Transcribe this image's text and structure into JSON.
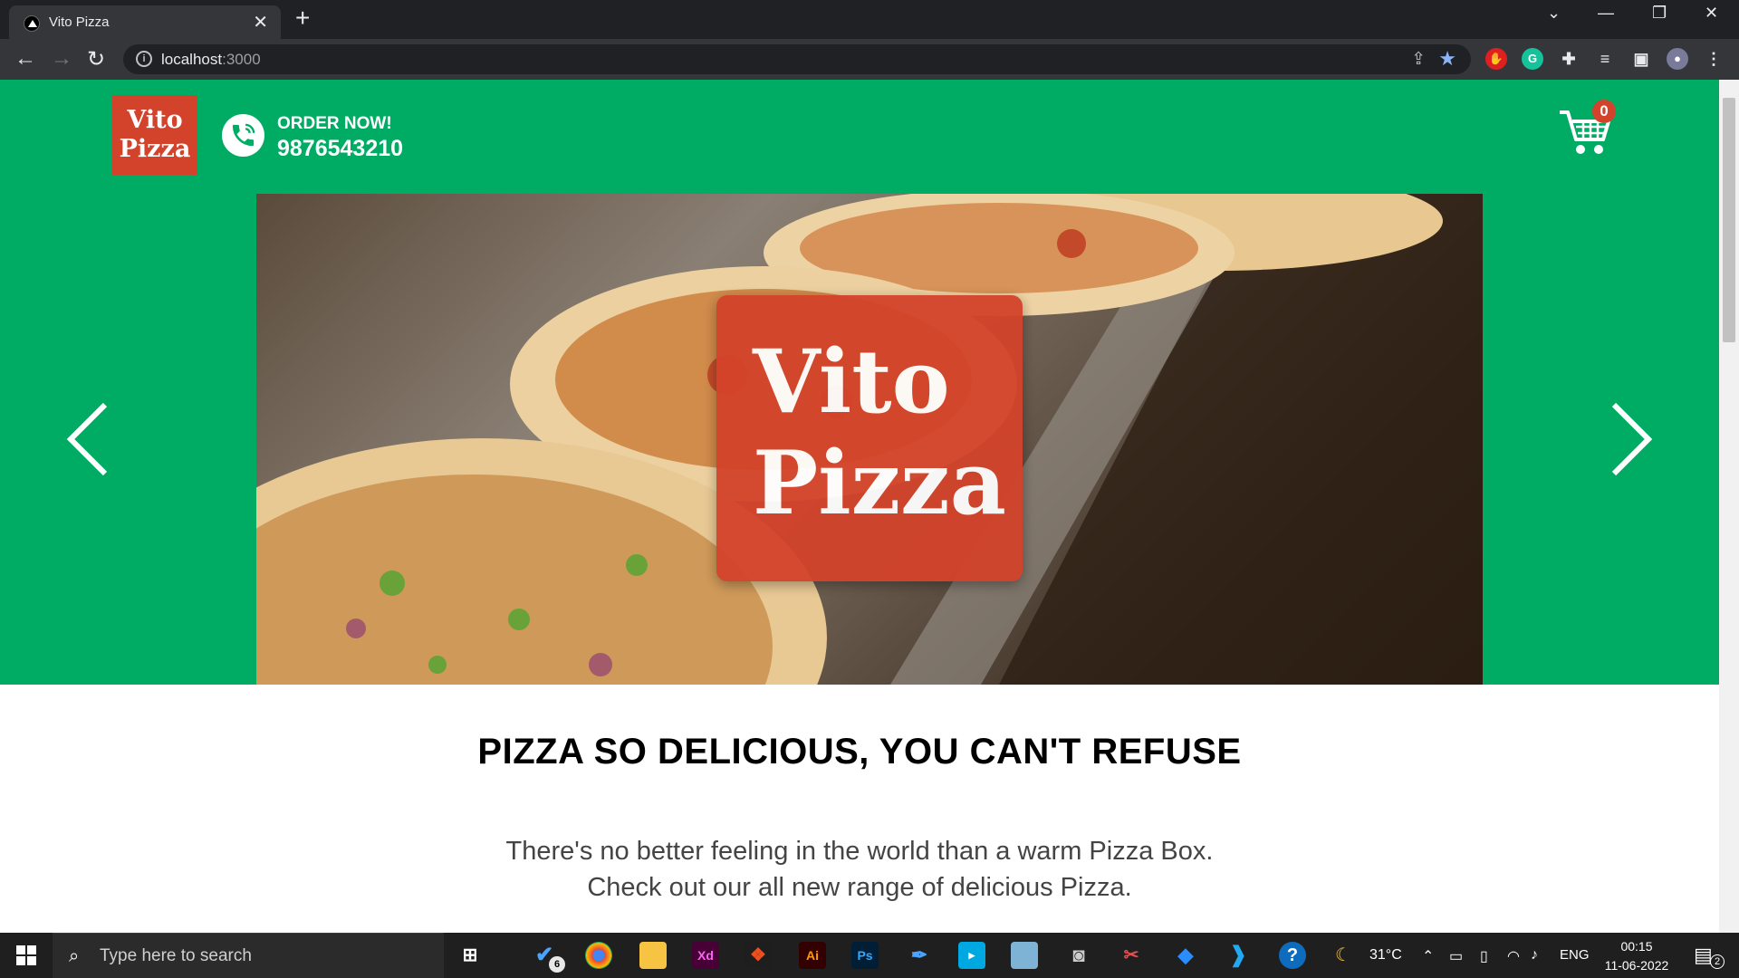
{
  "browser": {
    "tab_title": "Vito Pizza",
    "tab_close": "✕",
    "new_tab": "+",
    "url_host": "localhost",
    "url_port": ":3000"
  },
  "header": {
    "logo_line1": "Vito",
    "logo_line2": "Pizza",
    "order_label": "ORDER NOW!",
    "phone": "9876543210",
    "cart_count": "0"
  },
  "carousel": {
    "slide_logo_line1": "Vito",
    "slide_logo_line2": "Pizza"
  },
  "section": {
    "title": "PIZZA SO DELICIOUS, YOU CAN'T REFUSE",
    "desc_line1": "There's no better feeling in the world than a warm Pizza Box.",
    "desc_line2": "Check out our all new range of delicious Pizza."
  },
  "taskbar": {
    "search_placeholder": "Type here to search",
    "todo_badge": "6",
    "weather": "31°C",
    "lang": "ENG",
    "time": "00:15",
    "date": "11-06-2022",
    "notif_count": "2",
    "xd": "Xd",
    "ai": "Ai",
    "ps": "Ps",
    "help": "?"
  },
  "colors": {
    "brand_green": "#00ac64",
    "brand_red": "#d3432b"
  }
}
